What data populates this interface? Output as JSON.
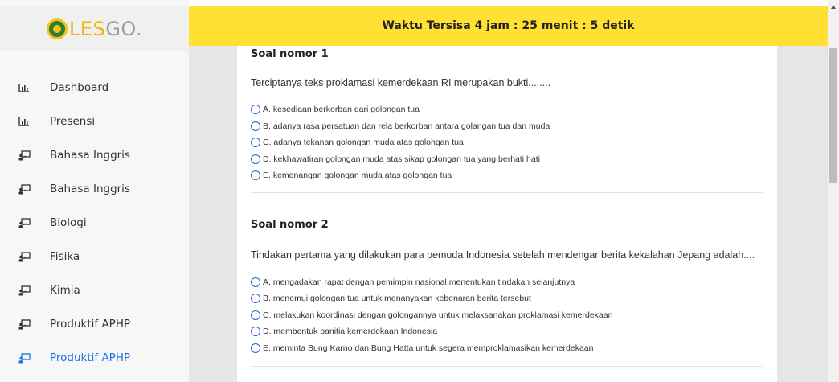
{
  "brand": {
    "logo_prefix": "",
    "logo_text_colored": "LES",
    "logo_text_gray": "GO.",
    "colors": {
      "accent": "#f4b400",
      "green": "#2e7d32"
    }
  },
  "header": {
    "timer_text": "Waktu Tersisa 4 jam : 25 menit : 5 detik",
    "bg_color": "#ffe033"
  },
  "sidebar": {
    "items": [
      {
        "label": "Dashboard",
        "icon": "bar-chart-icon",
        "active": false
      },
      {
        "label": "Presensi",
        "icon": "bar-chart-icon",
        "active": false
      },
      {
        "label": "Bahasa Inggris",
        "icon": "classroom-icon",
        "active": false
      },
      {
        "label": "Bahasa Inggris",
        "icon": "classroom-icon",
        "active": false
      },
      {
        "label": "Biologi",
        "icon": "classroom-icon",
        "active": false
      },
      {
        "label": "Fisika",
        "icon": "classroom-icon",
        "active": false
      },
      {
        "label": "Kimia",
        "icon": "classroom-icon",
        "active": false
      },
      {
        "label": "Produktif APHP",
        "icon": "classroom-icon",
        "active": false
      },
      {
        "label": "Produktif APHP",
        "icon": "classroom-icon",
        "active": true
      }
    ],
    "active_color": "#1a73e8"
  },
  "questions": [
    {
      "title": "Soal nomor 1",
      "text": "Terciptanya teks proklamasi kemerdekaan RI merupakan bukti........",
      "options": [
        "A. kesediaan berkorban dari golongan tua",
        "B. adanya rasa persatuan dan rela berkorban antara golangan tua dan muda",
        "C. adanya tekanan golongan muda atas golongan tua",
        "D. kekhawatiran golongan muda atas sikap golongan tua yang berhati hati",
        "E. kemenangan golongan muda atas golongan tua"
      ]
    },
    {
      "title": "Soal nomor 2",
      "text": "Tindakan pertama yang dilakukan para pemuda Indonesia setelah mendengar berita kekalahan Jepang adalah....",
      "options": [
        "A. mengadakan rapat dengan pemimpin nasional menentukan tindakan selanjutnya",
        "B. menemui golongan tua untuk menanyakan kebenaran berita tersebut",
        "C. melakukan koordinasi dengan golongannya untuk melaksanakan proklamasi kemerdekaan",
        "D. membentuk panitia kemerdekaan Indonesia",
        "E. meminta Bung Karno dan Bung Hatta untuk segera memproklamasikan kemerdekaan"
      ]
    }
  ]
}
